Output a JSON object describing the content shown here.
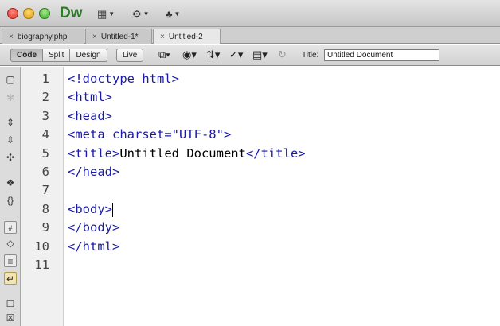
{
  "app": {
    "logo_text": "Dw",
    "window_controls": [
      "close",
      "minimize",
      "zoom"
    ]
  },
  "titlebar": {
    "layout_menu_icon": "layout-grid-icon",
    "settings_menu_icon": "gear-icon",
    "site_menu_icon": "site-map-icon"
  },
  "tabs": [
    {
      "label": "biography.php",
      "active": false
    },
    {
      "label": "Untitled-1*",
      "active": false
    },
    {
      "label": "Untitled-2",
      "active": true
    }
  ],
  "doc_toolbar": {
    "views": [
      "Code",
      "Split",
      "Design"
    ],
    "selected_view": "Code",
    "live_label": "Live",
    "title_label": "Title:",
    "title_value": "Untitled Document",
    "icons": [
      "multiscreen-icon",
      "browser-preview-icon",
      "file-management-icon",
      "validate-icon",
      "visual-aids-icon",
      "refresh-icon"
    ]
  },
  "coding_toolbar": {
    "icons": [
      "open-documents-icon",
      "show-code-navigator-icon",
      "collapse-full-tag-icon",
      "collapse-selection-icon",
      "expand-all-icon",
      "select-parent-tag-icon",
      "balance-braces-icon",
      "line-numbers-icon",
      "highlight-invalid-code-icon",
      "syntax-coloring-icon",
      "word-wrap-icon",
      "apply-comment-icon",
      "remove-comment-icon"
    ]
  },
  "editor": {
    "line_numbers": [
      "1",
      "2",
      "3",
      "4",
      "5",
      "6",
      "7",
      "8",
      "9",
      "10",
      "11"
    ],
    "lines": [
      [
        {
          "t": "<!doctype html>",
          "c": "tag"
        }
      ],
      [
        {
          "t": "<html>",
          "c": "tag"
        }
      ],
      [
        {
          "t": "<head>",
          "c": "tag"
        }
      ],
      [
        {
          "t": "<meta charset=\"UTF-8\">",
          "c": "tag"
        }
      ],
      [
        {
          "t": "<title>",
          "c": "tag"
        },
        {
          "t": "Untitled Document",
          "c": "txt"
        },
        {
          "t": "</title>",
          "c": "tag"
        }
      ],
      [
        {
          "t": "</head>",
          "c": "tag"
        }
      ],
      [],
      [
        {
          "t": "<body>",
          "c": "tag"
        }
      ],
      [
        {
          "t": "</body>",
          "c": "tag"
        }
      ],
      [
        {
          "t": "</html>",
          "c": "tag"
        }
      ],
      []
    ],
    "cursor_line": 8,
    "colors": {
      "tag": "#1a1aa6",
      "text": "#000000"
    }
  }
}
